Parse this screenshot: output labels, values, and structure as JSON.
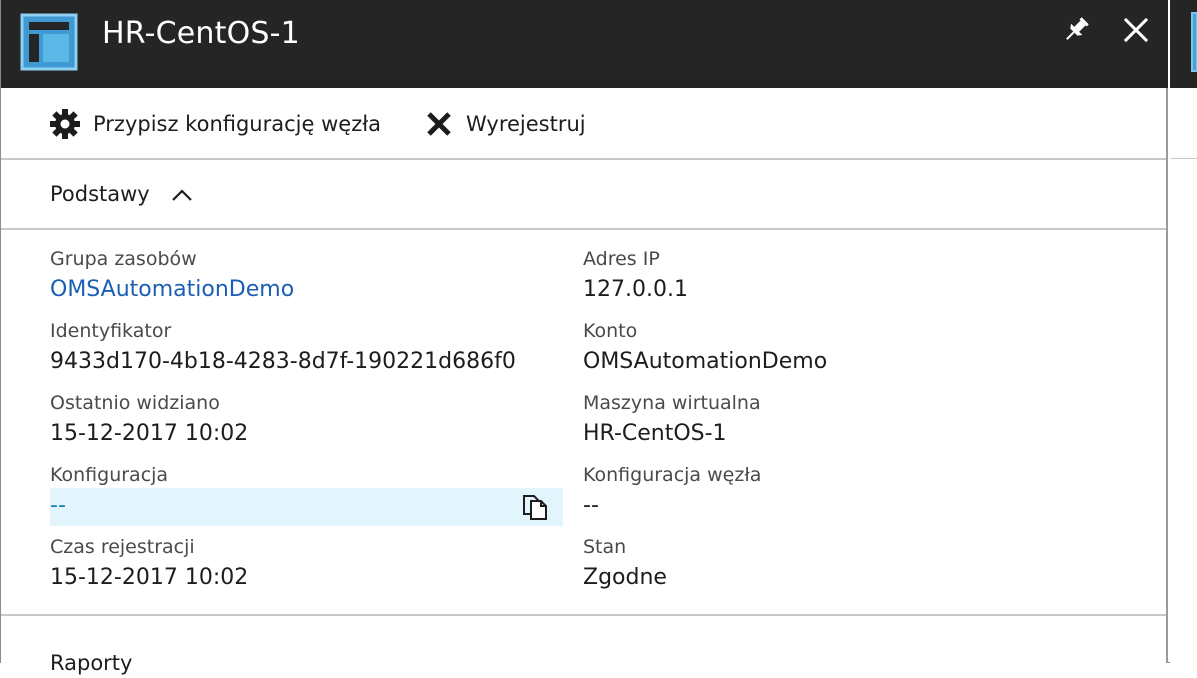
{
  "header": {
    "title": "HR-CentOS-1",
    "icon": "blade-icon",
    "pin_icon": "pin-icon",
    "close_icon": "close-icon"
  },
  "toolbar": {
    "assign_label": "Przypisz konfigurację węzła",
    "assign_icon": "gear-icon",
    "unregister_label": "Wyrejestruj",
    "unregister_icon": "x-icon"
  },
  "section": {
    "label": "Podstawy",
    "chevron_icon": "chevron-up-icon"
  },
  "essentials": {
    "left": [
      {
        "key": "Grupa zasobów",
        "value": "OMSAutomationDemo"
      },
      {
        "key": "Identyfikator",
        "value": "9433d170-4b18-4283-8d7f-190221d686f0"
      },
      {
        "key": "Ostatnio widziano",
        "value": "15-12-2017 10:02"
      },
      {
        "key": "Konfiguracja",
        "value": "--"
      },
      {
        "key": "Czas rejestracji",
        "value": "15-12-2017 10:02"
      }
    ],
    "right": [
      {
        "key": "Adres IP",
        "value": "127.0.0.1"
      },
      {
        "key": "Konto",
        "value": "OMSAutomationDemo"
      },
      {
        "key": "Maszyna wirtualna",
        "value": "HR-CentOS-1"
      },
      {
        "key": "Konfiguracja węzła",
        "value": "--"
      },
      {
        "key": "Stan",
        "value": "Zgodne"
      }
    ],
    "copy_icon": "copy-icon"
  },
  "next_section_cut": "Raporty",
  "colors": {
    "header_bg": "#252525",
    "accent": "#46a3d8",
    "link": "#1a5fb4",
    "copy_field_bg": "#e2f5fc"
  }
}
